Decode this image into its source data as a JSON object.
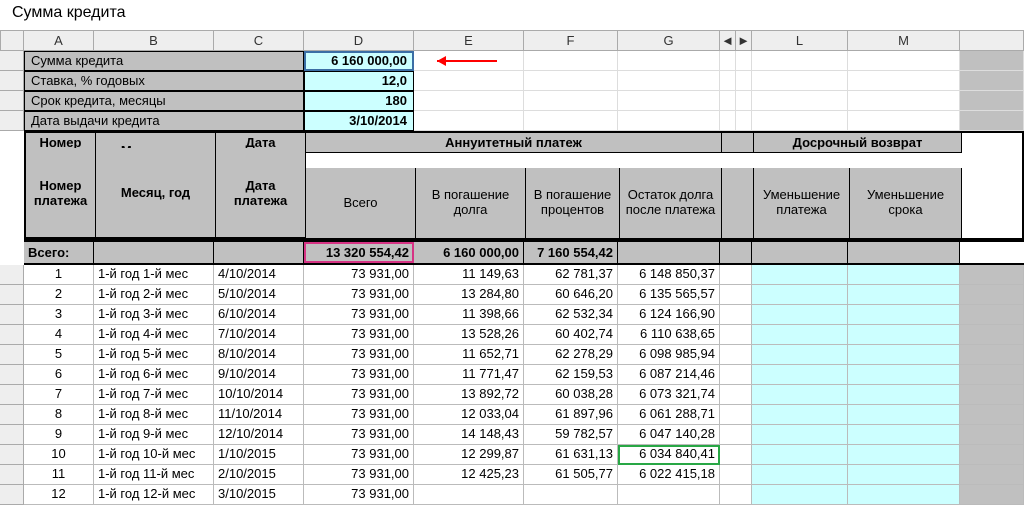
{
  "namebox": "Сумма кредита",
  "columns": [
    "",
    "A",
    "B",
    "C",
    "D",
    "E",
    "F",
    "G",
    "◄",
    "►",
    "L",
    "M",
    ""
  ],
  "summary": [
    {
      "label": "Сумма кредита",
      "value": "6 160 000,00"
    },
    {
      "label": "Ставка, % годовых",
      "value": "12,0"
    },
    {
      "label": "Срок кредита, месяцы",
      "value": "180"
    },
    {
      "label": "Дата выдачи кредита",
      "value": "3/10/2014"
    }
  ],
  "headers": {
    "top_left": [
      "Номер платежа",
      "Месяц, год",
      "Дата платежа"
    ],
    "annuity": "Аннуитетный платеж",
    "early": "Досрочный возврат",
    "annuity_cols": [
      "Всего",
      "В погашение долга",
      "В погашение процентов",
      "Остаток долга после платежа"
    ],
    "early_cols": [
      "Уменьшение платежа",
      "Уменьшение срока"
    ]
  },
  "totals": {
    "label": "Всего:",
    "values": [
      "13 320 554,42",
      "6 160 000,00",
      "7 160 554,42"
    ]
  },
  "payments": [
    {
      "n": "1",
      "m": "1-й год 1-й мес",
      "d": "4/10/2014",
      "total": "73 931,00",
      "body": "11 149,63",
      "pct": "62 781,37",
      "rest": "6 148 850,37"
    },
    {
      "n": "2",
      "m": "1-й год 2-й мес",
      "d": "5/10/2014",
      "total": "73 931,00",
      "body": "13 284,80",
      "pct": "60 646,20",
      "rest": "6 135 565,57"
    },
    {
      "n": "3",
      "m": "1-й год 3-й мес",
      "d": "6/10/2014",
      "total": "73 931,00",
      "body": "11 398,66",
      "pct": "62 532,34",
      "rest": "6 124 166,90"
    },
    {
      "n": "4",
      "m": "1-й год 4-й мес",
      "d": "7/10/2014",
      "total": "73 931,00",
      "body": "13 528,26",
      "pct": "60 402,74",
      "rest": "6 110 638,65"
    },
    {
      "n": "5",
      "m": "1-й год 5-й мес",
      "d": "8/10/2014",
      "total": "73 931,00",
      "body": "11 652,71",
      "pct": "62 278,29",
      "rest": "6 098 985,94"
    },
    {
      "n": "6",
      "m": "1-й год 6-й мес",
      "d": "9/10/2014",
      "total": "73 931,00",
      "body": "11 771,47",
      "pct": "62 159,53",
      "rest": "6 087 214,46"
    },
    {
      "n": "7",
      "m": "1-й год 7-й мес",
      "d": "10/10/2014",
      "total": "73 931,00",
      "body": "13 892,72",
      "pct": "60 038,28",
      "rest": "6 073 321,74"
    },
    {
      "n": "8",
      "m": "1-й год 8-й мес",
      "d": "11/10/2014",
      "total": "73 931,00",
      "body": "12 033,04",
      "pct": "61 897,96",
      "rest": "6 061 288,71"
    },
    {
      "n": "9",
      "m": "1-й год 9-й мес",
      "d": "12/10/2014",
      "total": "73 931,00",
      "body": "14 148,43",
      "pct": "59 782,57",
      "rest": "6 047 140,28"
    },
    {
      "n": "10",
      "m": "1-й год 10-й мес",
      "d": "1/10/2015",
      "total": "73 931,00",
      "body": "12 299,87",
      "pct": "61 631,13",
      "rest": "6 034 840,41"
    },
    {
      "n": "11",
      "m": "1-й год 11-й мес",
      "d": "2/10/2015",
      "total": "73 931,00",
      "body": "12 425,23",
      "pct": "61 505,77",
      "rest": "6 022 415,18"
    },
    {
      "n": "12",
      "m": "1-й год 12-й мес",
      "d": "3/10/2015",
      "total": "73 931,00",
      "body": "",
      "pct": "",
      "rest": ""
    }
  ],
  "nav": {
    "left": "◄",
    "right": "►"
  }
}
